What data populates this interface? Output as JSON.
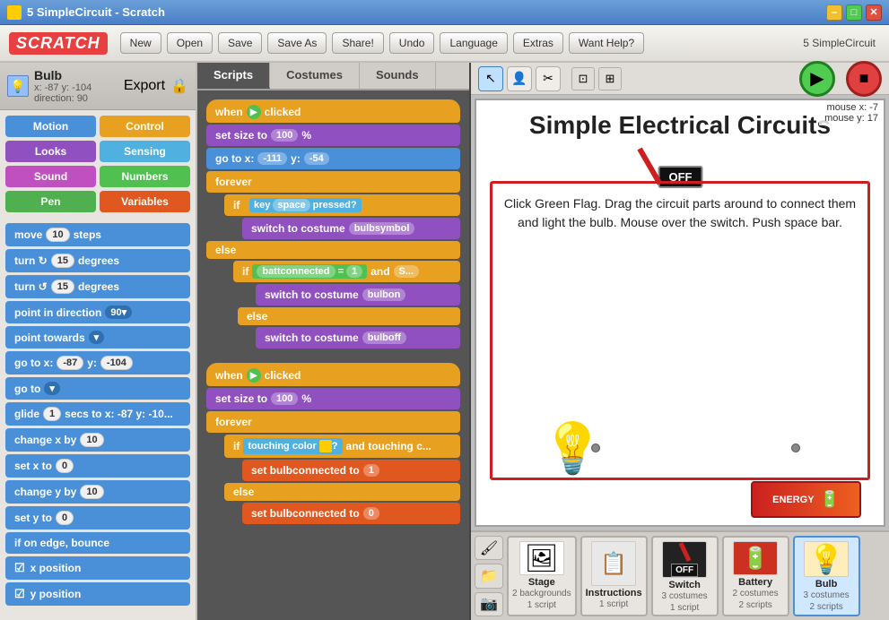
{
  "titlebar": {
    "title": "5 SimpleCircuit - Scratch",
    "min_label": "–",
    "max_label": "□",
    "close_label": "✕"
  },
  "toolbar": {
    "logo": "SCRATCH",
    "new_label": "New",
    "open_label": "Open",
    "save_label": "Save",
    "save_as_label": "Save As",
    "share_label": "Share!",
    "undo_label": "Undo",
    "language_label": "Language",
    "extras_label": "Extras",
    "help_label": "Want Help?",
    "project_name": "5 SimpleCircuit"
  },
  "sprite_header": {
    "name": "Bulb",
    "position": "x: -87  y: -104  direction: 90"
  },
  "categories": {
    "motion": "Motion",
    "control": "Control",
    "looks": "Looks",
    "sensing": "Sensing",
    "sound": "Sound",
    "numbers": "Numbers",
    "pen": "Pen",
    "variables": "Variables"
  },
  "blocks": [
    {
      "label": "move",
      "value": "10",
      "suffix": "steps"
    },
    {
      "label": "turn ↻",
      "value": "15",
      "suffix": "degrees"
    },
    {
      "label": "turn ↺",
      "value": "15",
      "suffix": "degrees"
    },
    {
      "label": "point in direction",
      "value": "90▾"
    },
    {
      "label": "point towards",
      "dropdown": "▾"
    },
    {
      "label": "go to x:",
      "value": "-87",
      "suffix": "y:",
      "value2": "-104"
    },
    {
      "label": "go to",
      "dropdown": "▾"
    },
    {
      "label": "glide",
      "value": "1",
      "suffix": "secs to x: -87  y: -10"
    },
    {
      "label": "change x by",
      "value": "10"
    },
    {
      "label": "set x to",
      "value": "0"
    },
    {
      "label": "change y by",
      "value": "10"
    },
    {
      "label": "set y to",
      "value": "0"
    },
    {
      "label": "if on edge, bounce"
    },
    {
      "label": "x position",
      "checked": true
    },
    {
      "label": "y position",
      "checked": true
    }
  ],
  "script_tabs": {
    "scripts": "Scripts",
    "costumes": "Costumes",
    "sounds": "Sounds"
  },
  "scripts": [
    {
      "id": "script1",
      "blocks": [
        {
          "type": "hat",
          "label": "when",
          "flag": true,
          "suffix": "clicked"
        },
        {
          "type": "looks",
          "label": "set size to",
          "value": "100",
          "suffix": "%"
        },
        {
          "type": "motion",
          "label": "go to x:",
          "value": "-111",
          "suffix": "y:",
          "value2": "-54"
        },
        {
          "type": "control",
          "label": "forever"
        },
        {
          "type": "if",
          "label": "if",
          "condition": "key",
          "key": "space",
          "suffix": "pressed?"
        },
        {
          "type": "looks-indent",
          "label": "switch to costume",
          "value": "bulbsymbol"
        },
        {
          "type": "else"
        },
        {
          "type": "if-indent",
          "label": "if",
          "cond1": "battconnected",
          "op": "=",
          "val": "1",
          "suffix": "and",
          "rest": "S..."
        },
        {
          "type": "looks-indent2",
          "label": "switch to costume",
          "value": "bulbon"
        },
        {
          "type": "else2"
        },
        {
          "type": "looks-indent2",
          "label": "switch to costume",
          "value": "bulboff"
        }
      ]
    },
    {
      "id": "script2",
      "blocks": [
        {
          "type": "hat",
          "label": "when",
          "flag": true,
          "suffix": "clicked"
        },
        {
          "type": "looks",
          "label": "set size to",
          "value": "100",
          "suffix": "%"
        },
        {
          "type": "control",
          "label": "forever"
        },
        {
          "type": "if",
          "label": "if",
          "cond": "touching color",
          "color": "#ffcc00",
          "suffix": "? and touching c..."
        },
        {
          "type": "vars-indent",
          "label": "set bulbconnected to",
          "value": "1"
        },
        {
          "type": "else"
        },
        {
          "type": "vars-indent",
          "label": "set bulbconnected to",
          "value": "0"
        }
      ]
    }
  ],
  "stage": {
    "title": "Simple Electrical Circuits",
    "switch_label": "OFF",
    "circuit_text": "Click Green Flag. Drag the circuit parts around to connect them and light the bulb. Mouse over the switch. Push space bar.",
    "battery_label": "ENERGY"
  },
  "mouse_coords": {
    "x_label": "mouse x: -7",
    "y_label": "mouse y: 17"
  },
  "sprites": [
    {
      "id": "stage",
      "name": "Stage",
      "info": "2 backgrounds\n1 script",
      "icon": "🖼"
    },
    {
      "id": "instructions",
      "name": "Instructions",
      "info": "1 script",
      "icon": "📋"
    },
    {
      "id": "switch",
      "name": "Switch",
      "info": "3 costumes\n1 script",
      "icon": "🔌"
    },
    {
      "id": "battery",
      "name": "Battery",
      "info": "2 costumes\n2 scripts",
      "icon": "🔋"
    },
    {
      "id": "bulb",
      "name": "Bulb",
      "info": "3 costumes\n2 scripts",
      "icon": "💡",
      "active": true
    }
  ]
}
